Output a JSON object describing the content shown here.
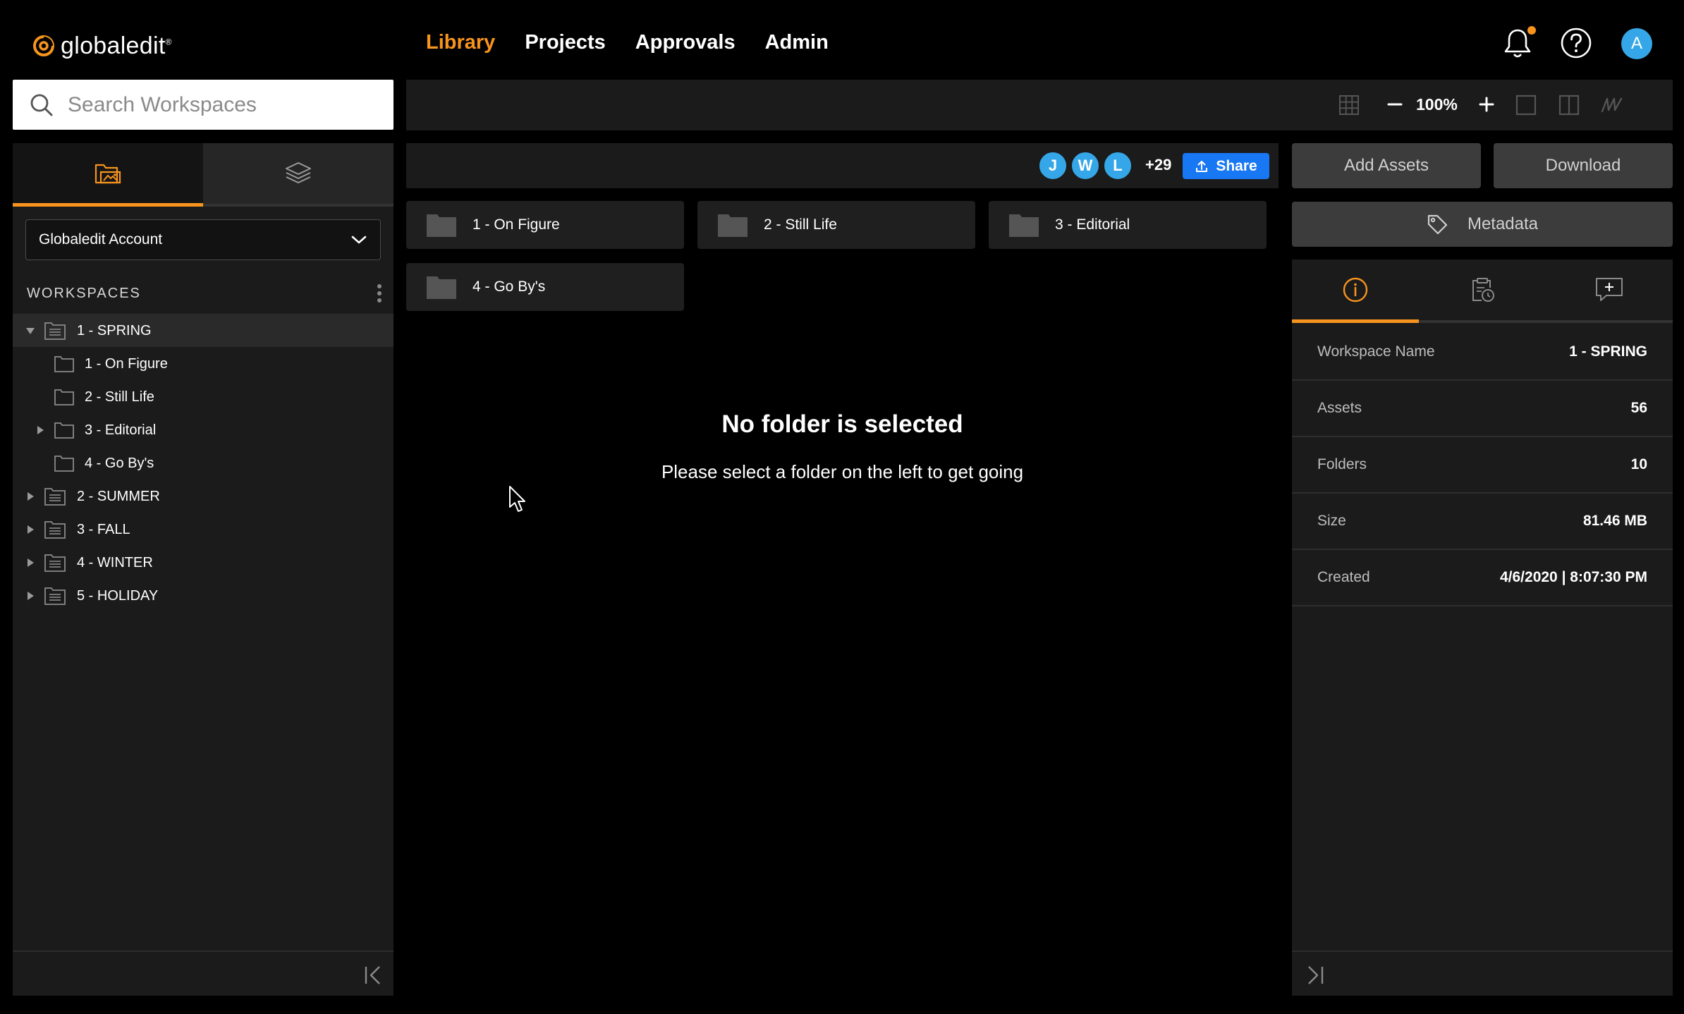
{
  "app": {
    "logo_text": "globaledit",
    "logo_mark": "®"
  },
  "nav": {
    "items": [
      {
        "label": "Library",
        "active": true
      },
      {
        "label": "Projects",
        "active": false
      },
      {
        "label": "Approvals",
        "active": false
      },
      {
        "label": "Admin",
        "active": false
      }
    ]
  },
  "user": {
    "initial": "A"
  },
  "search": {
    "placeholder": "Search Workspaces"
  },
  "sidebar": {
    "account": "Globaledit Account",
    "workspaces_heading": "WORKSPACES",
    "tree": [
      {
        "label": "1 - SPRING",
        "type": "workspace",
        "expanded": true,
        "selected": true
      },
      {
        "label": "1 - On Figure",
        "type": "folder"
      },
      {
        "label": "2 - Still Life",
        "type": "folder"
      },
      {
        "label": "3 - Editorial",
        "type": "folder",
        "has_children": true
      },
      {
        "label": "4 - Go By's",
        "type": "folder"
      },
      {
        "label": "2 - SUMMER",
        "type": "workspace"
      },
      {
        "label": "3 - FALL",
        "type": "workspace"
      },
      {
        "label": "4 - WINTER",
        "type": "workspace"
      },
      {
        "label": "5 - HOLIDAY",
        "type": "workspace"
      }
    ]
  },
  "toolbar": {
    "zoom": "100%"
  },
  "share_bar": {
    "avatars": [
      "J",
      "W",
      "L"
    ],
    "more_count": "+29",
    "share_label": "Share"
  },
  "folders": [
    "1 - On Figure",
    "2 - Still Life",
    "3 - Editorial",
    "4 - Go By's"
  ],
  "empty_state": {
    "title": "No folder is selected",
    "subtitle": "Please select a folder on the left to get going"
  },
  "actions": {
    "add_assets": "Add Assets",
    "download": "Download",
    "metadata": "Metadata"
  },
  "details": [
    {
      "key": "Workspace Name",
      "value": "1 - SPRING"
    },
    {
      "key": "Assets",
      "value": "56"
    },
    {
      "key": "Folders",
      "value": "10"
    },
    {
      "key": "Size",
      "value": "81.46 MB"
    },
    {
      "key": "Created",
      "value": "4/6/2020 | 8:07:30 PM"
    }
  ],
  "colors": {
    "accent": "#f7941e",
    "share": "#1877f2",
    "avatar": "#35a7e8"
  }
}
